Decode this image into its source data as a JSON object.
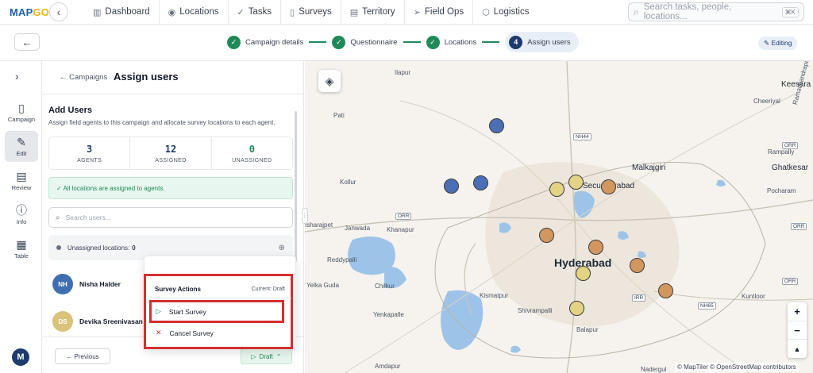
{
  "app": {
    "logo_main": "MAP",
    "logo_accent": "GO"
  },
  "nav": {
    "items": [
      {
        "label": "Dashboard",
        "icon": "bar-chart-icon"
      },
      {
        "label": "Locations",
        "icon": "pin-icon"
      },
      {
        "label": "Tasks",
        "icon": "check-icon"
      },
      {
        "label": "Surveys",
        "icon": "clipboard-icon"
      },
      {
        "label": "Territory",
        "icon": "map-icon"
      },
      {
        "label": "Field Ops",
        "icon": "send-icon"
      },
      {
        "label": "Logistics",
        "icon": "box-icon"
      }
    ],
    "search_placeholder": "Search tasks, people, locations...",
    "search_shortcut": "⌘K"
  },
  "stepper": {
    "steps": [
      {
        "num": "✓",
        "label": "Campaign details"
      },
      {
        "num": "✓",
        "label": "Questionnaire"
      },
      {
        "num": "✓",
        "label": "Locations"
      },
      {
        "num": "4",
        "label": "Assign users"
      }
    ],
    "status": "✎ Editing"
  },
  "rail": {
    "items": [
      {
        "label": "Campaign",
        "icon": "clipboard-icon"
      },
      {
        "label": "Edit",
        "icon": "edit-icon"
      },
      {
        "label": "Review",
        "icon": "document-icon"
      },
      {
        "label": "Info",
        "icon": "info-icon"
      },
      {
        "label": "Table",
        "icon": "grid-icon"
      }
    ],
    "user_initial": "M"
  },
  "panel": {
    "back_link": "← Campaigns",
    "title": "Assign users",
    "section_title": "Add Users",
    "section_subtitle": "Assign field agents to this campaign and allocate survey locations to each agent.",
    "stats": [
      {
        "value": "3",
        "label": "AGENTS",
        "color": "#1e3a6e"
      },
      {
        "value": "12",
        "label": "ASSIGNED",
        "color": "#1e3a6e"
      },
      {
        "value": "0",
        "label": "UNASSIGNED",
        "color": "#1f8a57"
      }
    ],
    "alert": "✓ All locations are assigned to agents.",
    "search_placeholder": "Search users...",
    "unassigned_label": "Unassigned locations:",
    "unassigned_count": "0",
    "agents": [
      {
        "initials": "NH",
        "name": "Nisha Halder",
        "color": "#3f6fb0"
      },
      {
        "initials": "DS",
        "name": "Devika Sreenivasan",
        "color": "#d9c27a"
      }
    ],
    "prev_button": "← Previous",
    "draft_button": "Draft"
  },
  "popup": {
    "title": "Survey Actions",
    "current": "Current: Draft",
    "start": "Start Survey",
    "cancel": "Cancel Survey"
  },
  "map": {
    "labels": {
      "hyderabad": "Hyderabad",
      "secunderabad": "Secunderabad",
      "malkajgiri": "Malkajgiri",
      "keesara": "Keesara",
      "cheeriyal": "Cheeriyal",
      "rampally": "Rampally",
      "ghatkesar": "Ghatkesar",
      "pocharam": "Pocharam",
      "patancheru": "Patancheru",
      "pati": "Pati",
      "kollur": "Kollur",
      "iseharajpet": "Isharajpet",
      "janwada": "Janwada",
      "khanapur": "Khanapur",
      "reddypalli": "Reddypalli",
      "yelkaguda": "Yelka Guda",
      "chilkur": "Chilkur",
      "kismatpur": "Kismatpur",
      "yenkapalle": "Yenkapalle",
      "shivrampalli": "Shivrampalli",
      "balapur": "Balapur",
      "kuntloor": "Kuntloor",
      "amdapur": "Amdapur",
      "nadergul": "Nadergul",
      "ilapur": "Ilapur",
      "ramchandrapuram": "Ramachandrapuram"
    },
    "shields": {
      "nh44": "NH44",
      "orr1": "ORR",
      "orr2": "ORR",
      "orr3": "ORR",
      "irr": "IRR",
      "nh65": "NH65",
      "orr4": "ORR"
    },
    "attribution": "© MapTiler © OpenStreetMap contributors",
    "marker_colors": {
      "blue": "#4a6fb5",
      "yellow": "#e2d385",
      "orange": "#d2965f"
    }
  }
}
